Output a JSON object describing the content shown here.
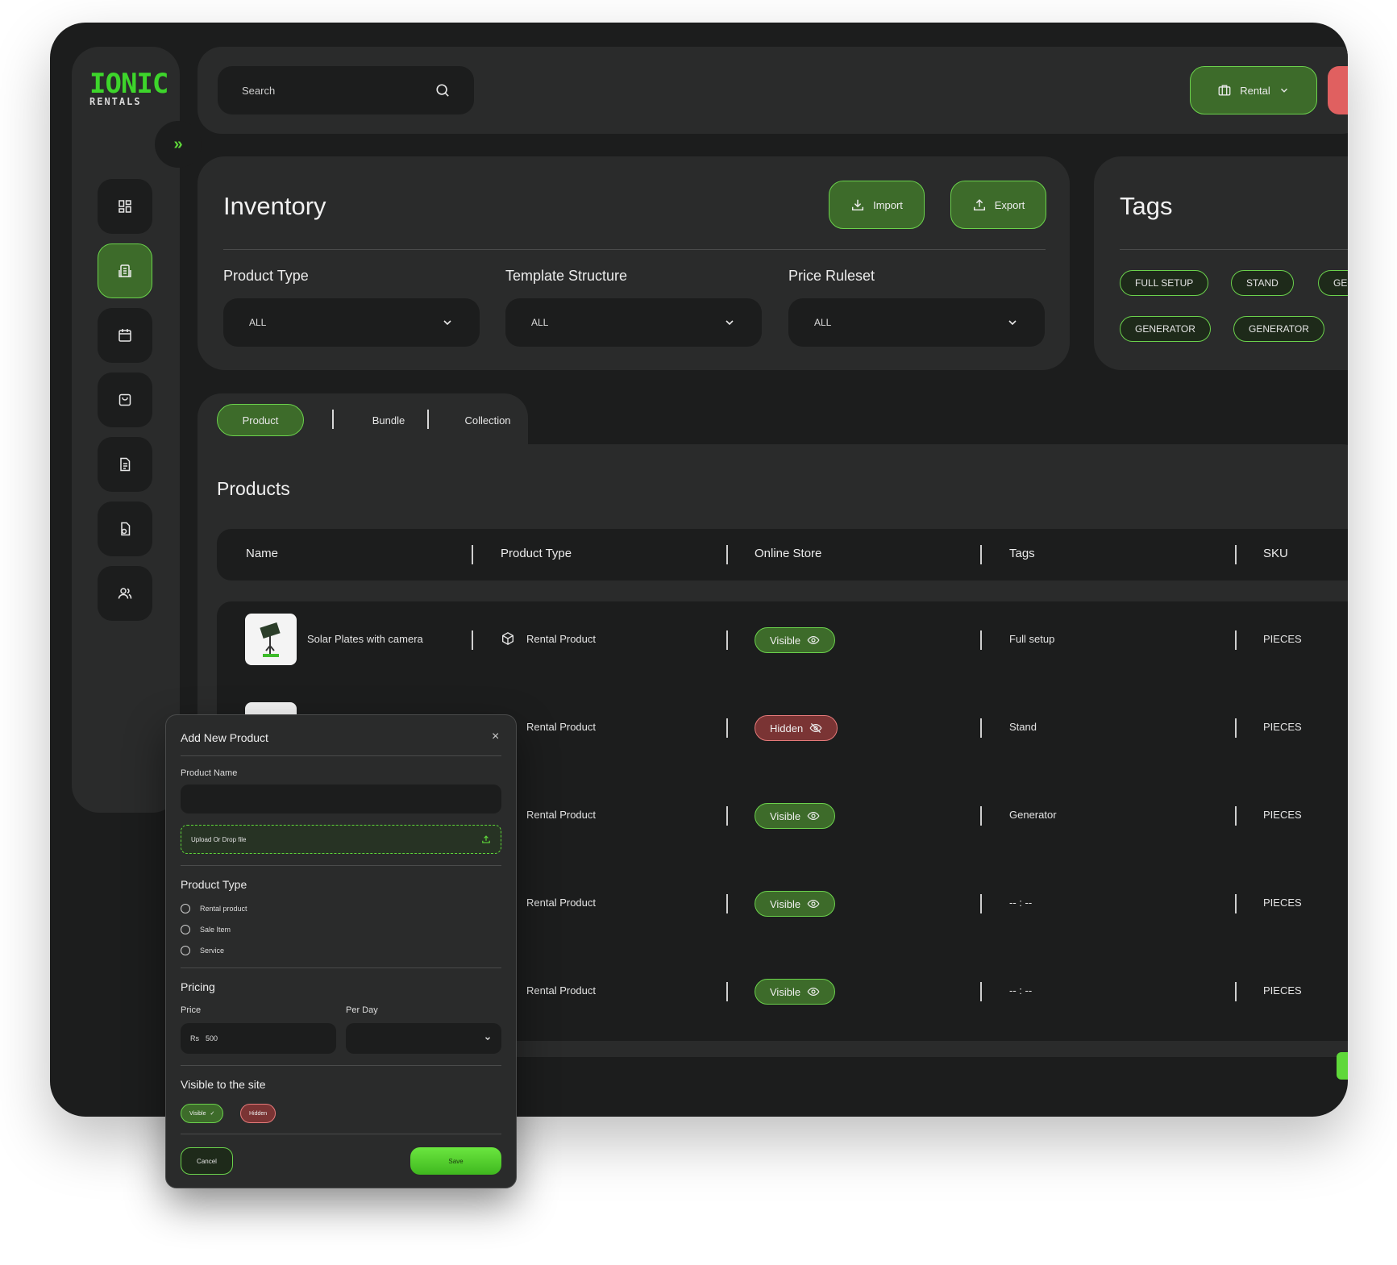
{
  "brand": {
    "logo_top": "IONIC",
    "logo_bottom": "RENTALS",
    "accent": "#5fd83a",
    "danger": "#e06060"
  },
  "topbar": {
    "search_placeholder": "Search",
    "mode_label": "Rental"
  },
  "sidebar": {
    "items": [
      "dashboard-icon",
      "inventory-icon",
      "calendar-icon",
      "orders-icon",
      "document-icon",
      "settings-icon",
      "users-icon"
    ],
    "active_index": 1
  },
  "inventory": {
    "title": "Inventory",
    "import_label": "Import",
    "export_label": "Export",
    "filters": [
      {
        "label": "Product Type",
        "value": "ALL"
      },
      {
        "label": "Template Structure",
        "value": "ALL"
      },
      {
        "label": "Price Ruleset",
        "value": "ALL"
      }
    ]
  },
  "tags": {
    "title": "Tags",
    "items": [
      "FULL SETUP",
      "STAND",
      "GE",
      "GENERATOR",
      "GENERATOR"
    ]
  },
  "tabs": {
    "items": [
      "Product",
      "Bundle",
      "Collection"
    ],
    "active": "Product"
  },
  "products": {
    "title": "Products",
    "columns": [
      "Name",
      "Product Type",
      "Online Store",
      "Tags",
      "SKU"
    ],
    "rows": [
      {
        "name": "Solar Plates with camera",
        "type": "Rental Product",
        "store": "Visible",
        "tags": "Full setup",
        "sku": "PIECES"
      },
      {
        "name": "",
        "type": "Rental Product",
        "store": "Hidden",
        "tags": "Stand",
        "sku": "PIECES"
      },
      {
        "name": "",
        "type": "Rental Product",
        "store": "Visible",
        "tags": "Generator",
        "sku": "PIECES"
      },
      {
        "name": "",
        "type": "Rental Product",
        "store": "Visible",
        "tags": "-- : --",
        "sku": "PIECES"
      },
      {
        "name": "",
        "type": "Rental Product",
        "store": "Visible",
        "tags": "-- : --",
        "sku": "PIECES"
      }
    ]
  },
  "modal": {
    "title": "Add New Product",
    "close": "×",
    "product_name_label": "Product Name",
    "upload_label": "Upload Or Drop file",
    "product_type_title": "Product Type",
    "product_type_options": [
      "Rental product",
      "Sale Item",
      "Service"
    ],
    "pricing_title": "Pricing",
    "price_label": "Price",
    "price_currency": "Rs",
    "price_value": "500",
    "per_label": "Per Day",
    "visibility_title": "Visible to the site",
    "visible_label": "Visible",
    "hidden_label": "Hidden",
    "cancel_label": "Cancel",
    "save_label": "Save"
  }
}
